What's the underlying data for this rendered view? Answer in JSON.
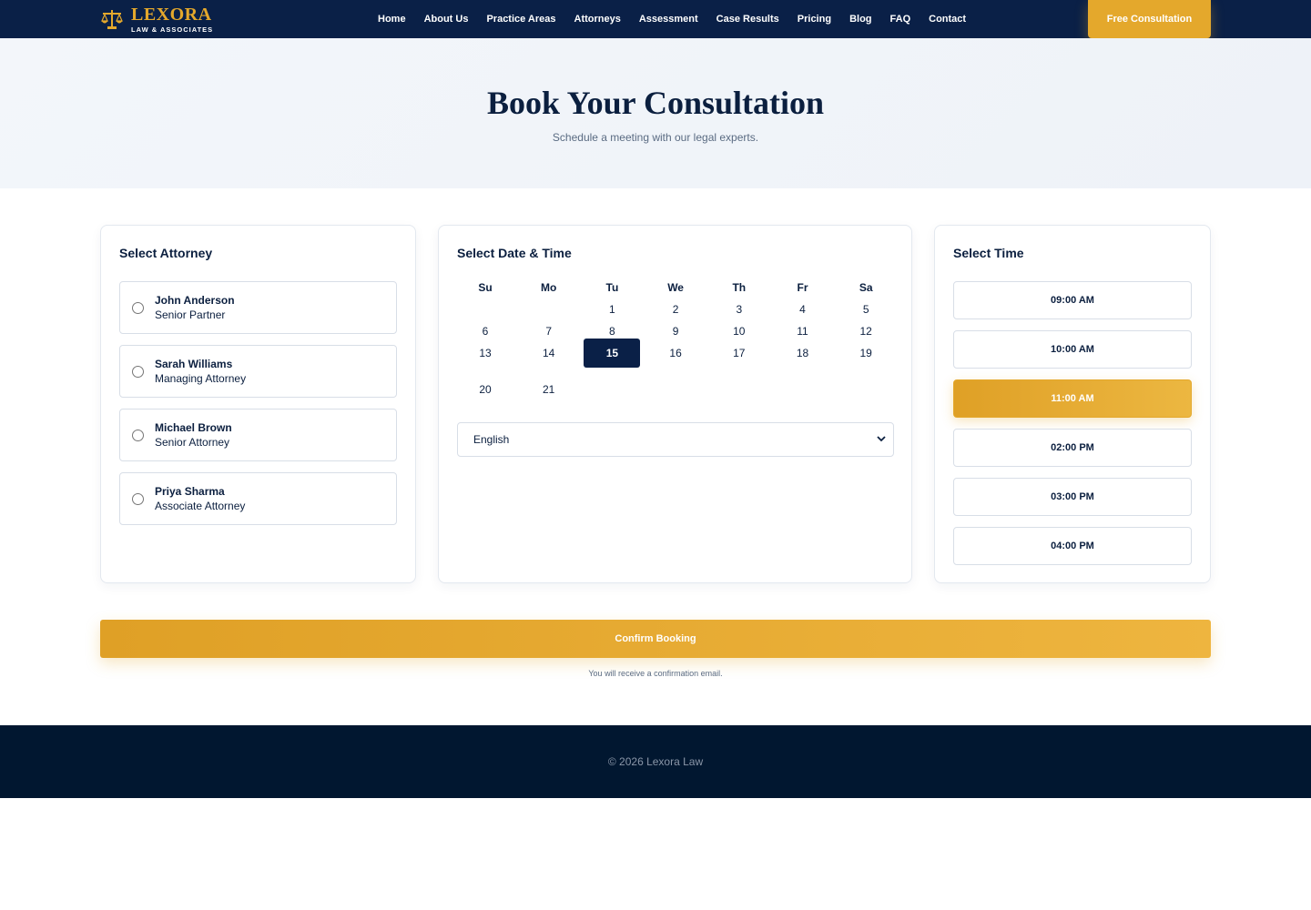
{
  "nav": {
    "brand_name": "LEXORA",
    "brand_sub": "LAW & ASSOCIATES",
    "logo_icon": "scales-icon",
    "links": [
      "Home",
      "About Us",
      "Practice Areas",
      "Attorneys",
      "Assessment",
      "Case Results",
      "Pricing",
      "Blog",
      "FAQ",
      "Contact"
    ],
    "cta": "Free Consultation"
  },
  "hero": {
    "title": "Book Your Consultation",
    "subtitle": "Schedule a meeting with our legal experts."
  },
  "attorney": {
    "title": "Select Attorney",
    "items": [
      {
        "name": "John Anderson",
        "role": "Senior Partner"
      },
      {
        "name": "Sarah Williams",
        "role": "Managing Attorney"
      },
      {
        "name": "Michael Brown",
        "role": "Senior Attorney"
      },
      {
        "name": "Priya Sharma",
        "role": "Associate Attorney"
      }
    ]
  },
  "date": {
    "title": "Select Date & Time",
    "weekdays": [
      "Su",
      "Mo",
      "Tu",
      "We",
      "Th",
      "Fr",
      "Sa"
    ],
    "first_weekday_index": 2,
    "days_in_view": 21,
    "selected_day": 15,
    "language": "English"
  },
  "time": {
    "title": "Select Time",
    "slots": [
      "09:00 AM",
      "10:00 AM",
      "11:00 AM",
      "02:00 PM",
      "03:00 PM",
      "04:00 PM"
    ],
    "selected": "11:00 AM"
  },
  "confirm": {
    "label": "Confirm Booking",
    "note": "You will receive a confirmation email."
  },
  "footer": {
    "text": "© 2026 Lexora Law"
  },
  "colors": {
    "navy": "#0a2047",
    "gold": "#e4a82c",
    "footer": "#011730"
  }
}
